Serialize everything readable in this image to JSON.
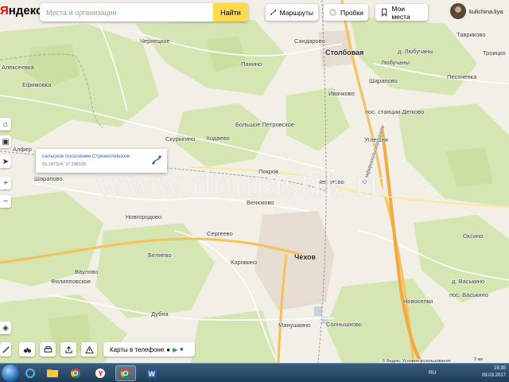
{
  "brand": {
    "logo_y": "Я",
    "logo_rest": "ндекс"
  },
  "search": {
    "placeholder": "Места и организации",
    "button": "Найти"
  },
  "top_buttons": {
    "routes": "Маршруты",
    "traffic": "Пробки",
    "my_places": "Мои места"
  },
  "user": {
    "name": "kulichina.liya"
  },
  "popup": {
    "title": "сельское поселение Стремиловское",
    "coords": "55.187324, 37.298199"
  },
  "places": {
    "alekseevka": "Алексеевка",
    "efimovka": "Ефимовка",
    "chernetskoe": "Чернецкое",
    "sandarovo": "Сандарово",
    "stolbovaya": "Столбовая",
    "lyubuchany_d": "д. Любучаны",
    "lyubuchany": "Любучаны",
    "taravikovo": "Тавриково",
    "troitskoe": "Троицко",
    "panino": "Панино",
    "ivachkovo": "Ивачково",
    "sharapovo_e": "Шарапово",
    "pesochenka": "Песоченка",
    "bolshoe_petrovskoe": "Большое Петровское",
    "pos_detkovo": "пос. станции Детково",
    "skurygino": "Скурыгино",
    "khodaevo": "Ходаево",
    "ugleshnya": "Углешня",
    "alfer": "Алфер",
    "sharapovo": "Шарапово",
    "pokrov": "Покров",
    "chepelevo": "Чепелёво",
    "novgorodovo": "Новгородово",
    "venyukovo": "Венюково",
    "sergeevo": "Сергеево",
    "belyaevo": "Беляево",
    "chekhov": "Чехов",
    "oksino": "Оксино",
    "vaulovo": "Ваулово",
    "korovino": "Коровино",
    "vaskino_d": "д. Васькино",
    "filippovskoe": "Филипповское",
    "vaskino_pos": "пос. Васькино",
    "novoselki": "Новоселки",
    "dubna": "Дубна",
    "manushkino": "Манушкино",
    "solnyshkovo": "Солнышково",
    "road_kharkov": "Симферопольское шоссе"
  },
  "watermark": "www.domastik.ru",
  "phone_widget": {
    "label": "Карты в телефоне"
  },
  "footer": {
    "copyright": "© Яндекс Условия использования",
    "scale": "2 км"
  },
  "taskbar": {
    "lang": "RU",
    "time": "15:35",
    "date": "09.03.2017"
  },
  "colors": {
    "accent": "#ffdb4d",
    "forest": "#d9e8b8",
    "field": "#f1efe6",
    "road_major": "#f7c15a"
  }
}
